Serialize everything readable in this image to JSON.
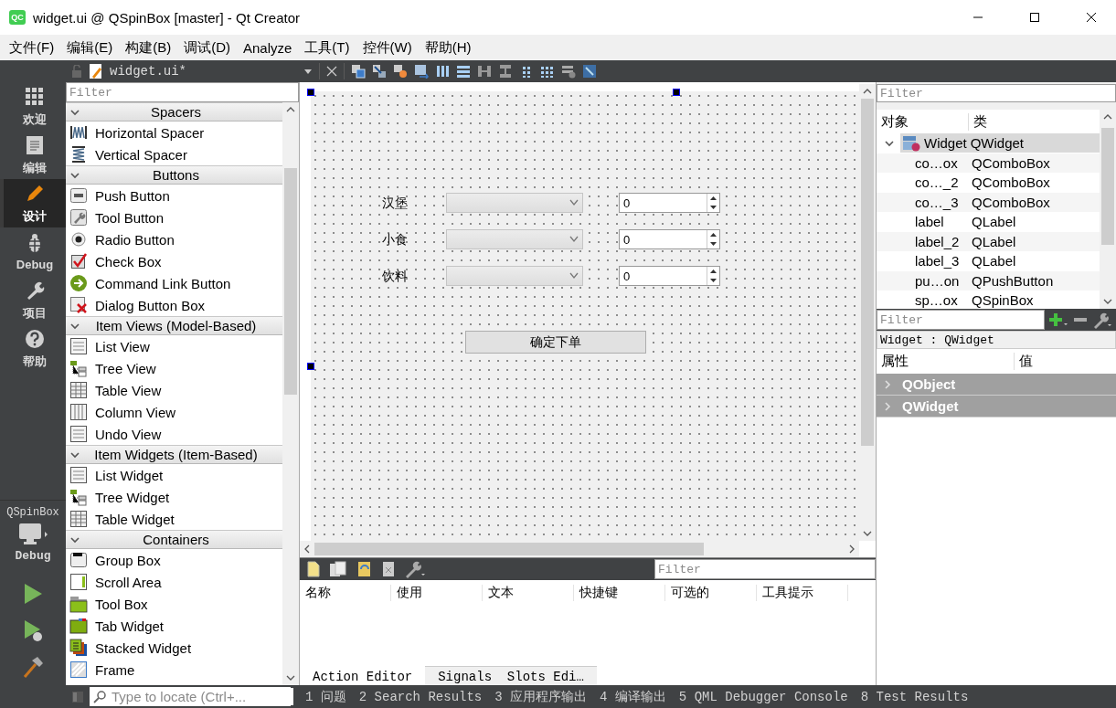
{
  "window": {
    "title": "widget.ui @ QSpinBox [master] - Qt Creator",
    "app_icon": "QC"
  },
  "menu": [
    "文件(F)",
    "编辑(E)",
    "构建(B)",
    "调试(D)",
    "Analyze",
    "工具(T)",
    "控件(W)",
    "帮助(H)"
  ],
  "modes": [
    {
      "label": "欢迎",
      "kind": "welcome",
      "selected": false
    },
    {
      "label": "编辑",
      "kind": "edit",
      "selected": false
    },
    {
      "label": "设计",
      "kind": "design",
      "selected": true
    },
    {
      "label": "Debug",
      "kind": "debug",
      "selected": false
    },
    {
      "label": "项目",
      "kind": "projects",
      "selected": false
    },
    {
      "label": "帮助",
      "kind": "help",
      "selected": false
    }
  ],
  "kit": {
    "project": "QSpinBox",
    "build": "Debug"
  },
  "editor_tab": {
    "filename": "widget.ui*"
  },
  "widget_box": {
    "filter_placeholder": "Filter",
    "categories": [
      {
        "name": "Spacers",
        "expanded": true,
        "items": [
          {
            "label": "Horizontal Spacer",
            "kind": "hspacer"
          },
          {
            "label": "Vertical Spacer",
            "kind": "vspacer"
          }
        ]
      },
      {
        "name": "Buttons",
        "expanded": true,
        "items": [
          {
            "label": "Push Button",
            "kind": "button"
          },
          {
            "label": "Tool Button",
            "kind": "tool"
          },
          {
            "label": "Radio Button",
            "kind": "radio"
          },
          {
            "label": "Check Box",
            "kind": "check"
          },
          {
            "label": "Command Link Button",
            "kind": "link"
          },
          {
            "label": "Dialog Button Box",
            "kind": "dialog"
          }
        ]
      },
      {
        "name": "Item Views (Model-Based)",
        "expanded": true,
        "items": [
          {
            "label": "List View",
            "kind": "list"
          },
          {
            "label": "Tree View",
            "kind": "tree"
          },
          {
            "label": "Table View",
            "kind": "table"
          },
          {
            "label": "Column View",
            "kind": "columns"
          },
          {
            "label": "Undo View",
            "kind": "list"
          }
        ]
      },
      {
        "name": "Item Widgets (Item-Based)",
        "expanded": true,
        "items": [
          {
            "label": "List Widget",
            "kind": "list"
          },
          {
            "label": "Tree Widget",
            "kind": "tree"
          },
          {
            "label": "Table Widget",
            "kind": "table"
          }
        ]
      },
      {
        "name": "Containers",
        "expanded": true,
        "items": [
          {
            "label": "Group Box",
            "kind": "group"
          },
          {
            "label": "Scroll Area",
            "kind": "scroll"
          },
          {
            "label": "Tool Box",
            "kind": "toolbox"
          },
          {
            "label": "Tab Widget",
            "kind": "tab"
          },
          {
            "label": "Stacked Widget",
            "kind": "stacked"
          },
          {
            "label": "Frame",
            "kind": "frame"
          }
        ]
      }
    ]
  },
  "form": {
    "rows": [
      {
        "label": "汉堡",
        "spin_value": "0"
      },
      {
        "label": "小食",
        "spin_value": "0"
      },
      {
        "label": "饮料",
        "spin_value": "0"
      }
    ],
    "button": "确定下单"
  },
  "action_editor": {
    "filter_placeholder": "Filter",
    "columns": [
      "名称",
      "使用",
      "文本",
      "快捷键",
      "可选的",
      "工具提示"
    ],
    "tabs": [
      {
        "label": "Action Editor",
        "selected": true
      },
      {
        "label": "Signals  Slots Edi…",
        "selected": false
      }
    ]
  },
  "object_inspector": {
    "filter_placeholder": "Filter",
    "columns": [
      "对象",
      "类"
    ],
    "root": {
      "name": "Widget",
      "class": "QWidget",
      "expanded": true,
      "selected": true,
      "children": [
        {
          "name": "co…ox",
          "class": "QComboBox"
        },
        {
          "name": "co…_2",
          "class": "QComboBox"
        },
        {
          "name": "co…_3",
          "class": "QComboBox"
        },
        {
          "name": "label",
          "class": "QLabel"
        },
        {
          "name": "label_2",
          "class": "QLabel"
        },
        {
          "name": "label_3",
          "class": "QLabel"
        },
        {
          "name": "pu…on",
          "class": "QPushButton"
        },
        {
          "name": "sp…ox",
          "class": "QSpinBox"
        }
      ]
    }
  },
  "property_editor": {
    "filter_placeholder": "Filter",
    "object": "Widget : QWidget",
    "columns": [
      "属性",
      "值"
    ],
    "groups": [
      {
        "name": "QObject",
        "expanded": false
      },
      {
        "name": "QWidget",
        "expanded": false
      }
    ]
  },
  "status_bar": {
    "locate_placeholder": "Type to locate (Ctrl+...",
    "panes": [
      "1 问题",
      "2 Search Results",
      "3 应用程序输出",
      "4 编译输出",
      "5 QML Debugger Console",
      "8 Test Results"
    ]
  }
}
